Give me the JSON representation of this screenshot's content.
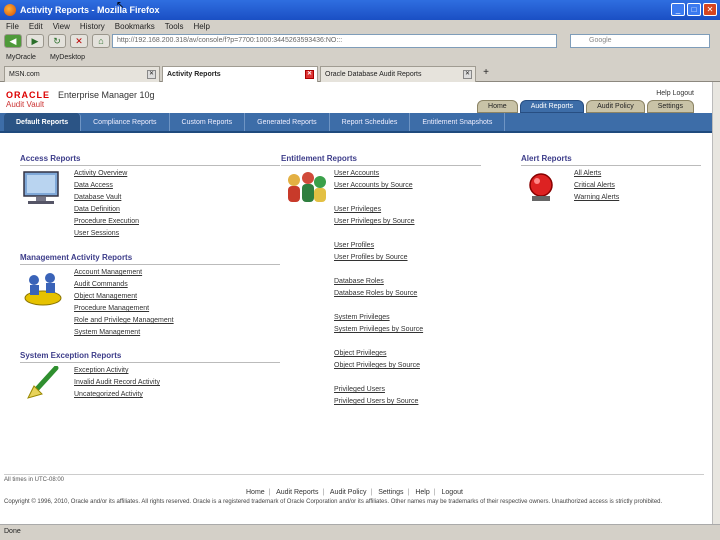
{
  "window": {
    "title": "Activity Reports - Mozilla Firefox"
  },
  "menu": [
    "File",
    "Edit",
    "View",
    "History",
    "Bookmarks",
    "Tools",
    "Help"
  ],
  "nav": {
    "url": "http://192.168.200.318/av/console/f?p=7700:1000:3445263593436:NO:::",
    "search_placeholder": "Google"
  },
  "bookmarks": [
    "MyOracle",
    "MyDesktop"
  ],
  "tabs": [
    {
      "label": "MSN.com"
    },
    {
      "label": "Activity Reports"
    },
    {
      "label": "Oracle Database Audit Reports"
    }
  ],
  "header": {
    "brand": "ORACLE",
    "product": "Enterprise Manager 10g",
    "subproduct": "Audit Vault",
    "links": "Help  Logout",
    "top_tabs": [
      "Home",
      "Audit Reports",
      "Audit Policy",
      "Settings"
    ],
    "sub_tabs": [
      "Default Reports",
      "Compliance Reports",
      "Custom Reports",
      "Generated Reports",
      "Report Schedules",
      "Entitlement Snapshots"
    ]
  },
  "access": {
    "title": "Access Reports",
    "links": [
      "Activity Overview",
      "Data Access",
      "Database Vault",
      "Data Definition",
      "Procedure Execution",
      "User Sessions"
    ]
  },
  "management": {
    "title": "Management Activity Reports",
    "links": [
      "Account Management",
      "Audit Commands",
      "Object Management",
      "Procedure Management",
      "Role and Privilege Management",
      "System Management"
    ]
  },
  "exception": {
    "title": "System Exception Reports",
    "links": [
      "Exception Activity",
      "Invalid Audit Record Activity",
      "Uncategorized Activity"
    ]
  },
  "entitlement": {
    "title": "Entitlement Reports",
    "links": [
      "User Accounts",
      "User Accounts by Source",
      "",
      "User Privileges",
      "User Privileges by Source",
      "",
      "User Profiles",
      "User Profiles by Source",
      "",
      "Database Roles",
      "Database Roles by Source",
      "",
      "System Privileges",
      "System Privileges by Source",
      "",
      "Object Privileges",
      "Object Privileges by Source",
      "",
      "Privileged Users",
      "Privileged Users by Source"
    ]
  },
  "alert": {
    "title": "Alert Reports",
    "links": [
      "All Alerts",
      "Critical Alerts",
      "Warning Alerts"
    ]
  },
  "footer": {
    "last": "All times in UTC-08:00",
    "links": [
      "Home",
      "Audit Reports",
      "Audit Policy",
      "Settings",
      "Help",
      "Logout"
    ],
    "copyright": "Copyright © 1996, 2010, Oracle and/or its affiliates. All rights reserved. Oracle is a registered trademark of Oracle Corporation and/or its affiliates. Other names may be trademarks of their respective owners. Unauthorized access is strictly prohibited."
  },
  "status": "Done"
}
